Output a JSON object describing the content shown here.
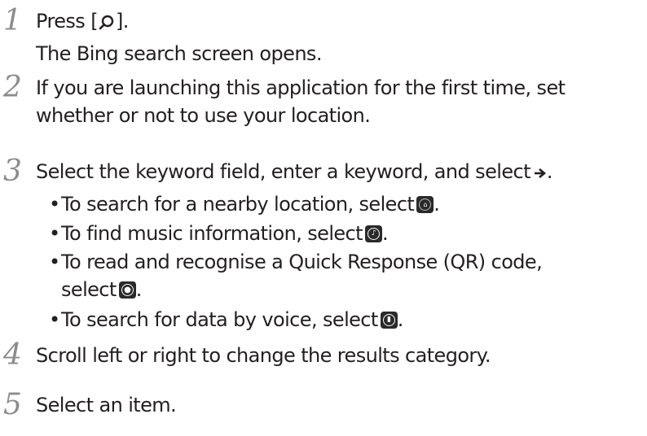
{
  "steps": [
    {
      "number": "1",
      "lines": {
        "l1_before": "Press [",
        "l1_after": "].",
        "l2": "The Bing search screen opens."
      }
    },
    {
      "number": "2",
      "lines": {
        "l1": "If you are launching this application for the first time, set",
        "l2": "whether or not to use your location."
      }
    },
    {
      "number": "3",
      "lines": {
        "l1": "Select the keyword field, enter a keyword, and select",
        "l1_end": "."
      },
      "bullets": [
        {
          "text": "To search for a nearby location, select",
          "end": ".",
          "icon": "location-icon"
        },
        {
          "text": "To find music information, select",
          "end": ".",
          "icon": "music-icon"
        },
        {
          "text": "To read and recognise a Quick Response (QR) code,",
          "text2": "select",
          "end": ".",
          "icon": "qr-eye-icon"
        },
        {
          "text": "To search for data by voice, select",
          "end": ".",
          "icon": "microphone-icon"
        }
      ]
    },
    {
      "number": "4",
      "lines": {
        "l1": "Scroll left or right to change the results category."
      }
    },
    {
      "number": "5",
      "lines": {
        "l1": "Select an item."
      }
    }
  ],
  "bullet_char": "•"
}
